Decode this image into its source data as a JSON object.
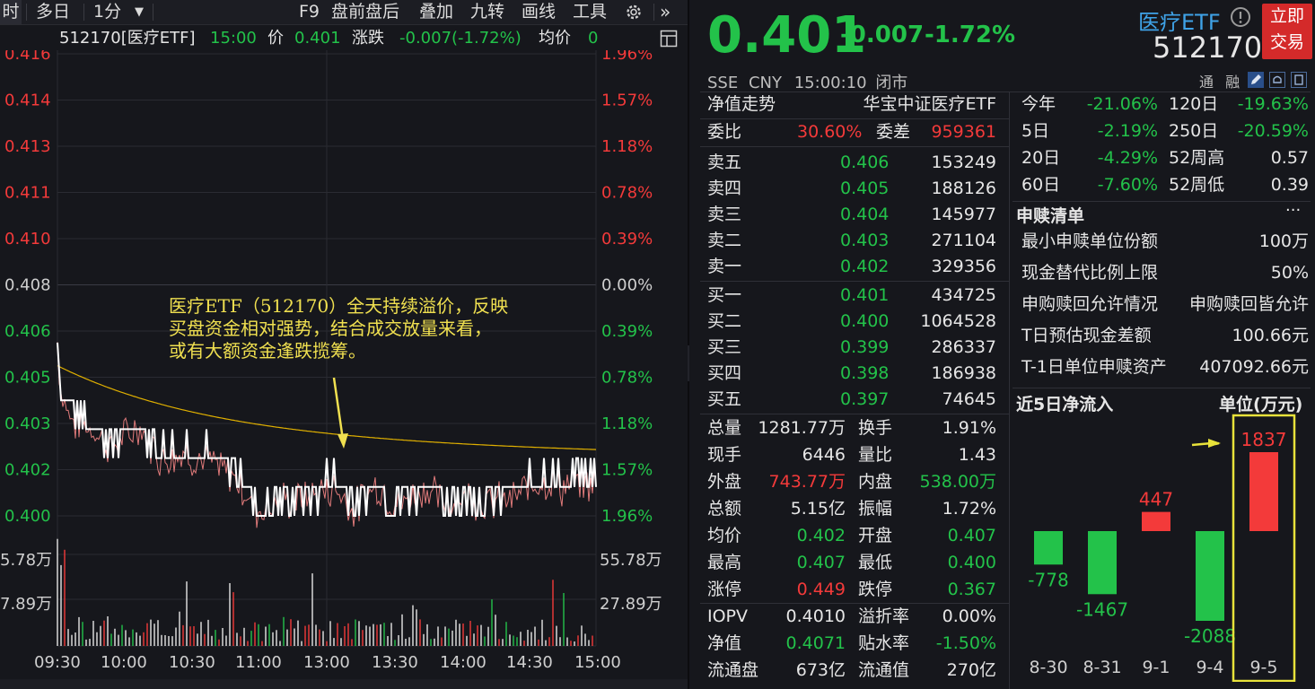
{
  "toolbar": {
    "items": [
      "时",
      "多日",
      "1分",
      "F9",
      "盘前盘后",
      "叠加",
      "九转",
      "画线",
      "工具"
    ],
    "settings_icon": "gear-icon",
    "more_icon": "double-chevron-right-icon"
  },
  "infobar": {
    "title": "512170[医疗ETF]",
    "time": "15:00",
    "price_label": "价",
    "price": "0.401",
    "change_label": "涨跌",
    "change": "-0.007(-1.72%)",
    "avg_label": "均价",
    "avg": "0"
  },
  "chart": {
    "left_ticks": [
      {
        "v": "0.416",
        "c": "up"
      },
      {
        "v": "0.414",
        "c": "up"
      },
      {
        "v": "0.413",
        "c": "up"
      },
      {
        "v": "0.411",
        "c": "up"
      },
      {
        "v": "0.410",
        "c": "up"
      },
      {
        "v": "0.408",
        "c": "flat"
      },
      {
        "v": "0.406",
        "c": "down"
      },
      {
        "v": "0.405",
        "c": "down"
      },
      {
        "v": "0.403",
        "c": "down"
      },
      {
        "v": "0.402",
        "c": "down"
      },
      {
        "v": "0.400",
        "c": "down"
      }
    ],
    "right_ticks": [
      {
        "v": "1.96%",
        "c": "up"
      },
      {
        "v": "1.57%",
        "c": "up"
      },
      {
        "v": "1.18%",
        "c": "up"
      },
      {
        "v": "0.78%",
        "c": "up"
      },
      {
        "v": "0.39%",
        "c": "up"
      },
      {
        "v": "0.00%",
        "c": "flat"
      },
      {
        "v": "0.39%",
        "c": "down"
      },
      {
        "v": "0.78%",
        "c": "down"
      },
      {
        "v": "1.18%",
        "c": "down"
      },
      {
        "v": "1.57%",
        "c": "down"
      },
      {
        "v": "1.96%",
        "c": "down"
      }
    ],
    "vol_left": [
      "5.78万",
      "7.89万"
    ],
    "vol_right": [
      "55.78万",
      "27.89万"
    ],
    "time_labels": [
      "09:30",
      "10:00",
      "10:30",
      "11:00",
      "13:00",
      "13:30",
      "14:00",
      "14:30",
      "15:00"
    ],
    "annotation": [
      "医疗ETF（512170）全天持续溢价，反映",
      "买盘资金相对强势，结合成交放量来看，",
      "或有大额资金逢跌揽筹。"
    ],
    "colors": {
      "up": "#f33a3a",
      "down": "#23c24a",
      "flat": "#cfcfcf",
      "price": "#ffffff",
      "iopv": "#e07a7a",
      "avg": "#e0b000",
      "annotation": "#f0e050"
    }
  },
  "header": {
    "price": "0.401",
    "change": "-0.007",
    "change_pct": "-1.72%",
    "name": "医疗ETF",
    "code": "512170",
    "info_icon": "exclamation-circle-icon",
    "trade_button": [
      "立即",
      "交易"
    ],
    "market": "SSE",
    "currency": "CNY",
    "time": "15:00:10",
    "status": "闭市",
    "tags": [
      "通",
      "融"
    ]
  },
  "order_book": {
    "nav_trend_label": "净值走势",
    "fund_name": "华宝中证医疗ETF",
    "weibi_label": "委比",
    "weibi": "30.60%",
    "weicha_label": "委差",
    "weicha": "959361",
    "asks": [
      {
        "label": "卖五",
        "price": "0.406",
        "vol": "153249"
      },
      {
        "label": "卖四",
        "price": "0.405",
        "vol": "188126"
      },
      {
        "label": "卖三",
        "price": "0.404",
        "vol": "145977"
      },
      {
        "label": "卖二",
        "price": "0.403",
        "vol": "271104"
      },
      {
        "label": "卖一",
        "price": "0.402",
        "vol": "329356"
      }
    ],
    "bids": [
      {
        "label": "买一",
        "price": "0.401",
        "vol": "434725"
      },
      {
        "label": "买二",
        "price": "0.400",
        "vol": "1064528"
      },
      {
        "label": "买三",
        "price": "0.399",
        "vol": "286337"
      },
      {
        "label": "买四",
        "price": "0.398",
        "vol": "186938"
      },
      {
        "label": "买五",
        "price": "0.397",
        "vol": "74645"
      }
    ],
    "stats": [
      {
        "l1": "总量",
        "v1": "1281.77万",
        "c1": "w",
        "l2": "换手",
        "v2": "1.91%",
        "c2": "w"
      },
      {
        "l1": "现手",
        "v1": "6446",
        "c1": "w",
        "l2": "量比",
        "v2": "1.43",
        "c2": "w"
      },
      {
        "l1": "外盘",
        "v1": "743.77万",
        "c1": "r",
        "l2": "内盘",
        "v2": "538.00万",
        "c2": "g"
      },
      {
        "l1": "总额",
        "v1": "5.15亿",
        "c1": "w",
        "l2": "振幅",
        "v2": "1.72%",
        "c2": "w"
      },
      {
        "l1": "均价",
        "v1": "0.402",
        "c1": "g",
        "l2": "开盘",
        "v2": "0.407",
        "c2": "g"
      },
      {
        "l1": "最高",
        "v1": "0.407",
        "c1": "g",
        "l2": "最低",
        "v2": "0.400",
        "c2": "g"
      },
      {
        "l1": "涨停",
        "v1": "0.449",
        "c1": "r",
        "l2": "跌停",
        "v2": "0.367",
        "c2": "g"
      }
    ],
    "stats2": [
      {
        "l1": "IOPV",
        "v1": "0.4010",
        "c1": "w",
        "l2": "溢折率",
        "v2": "0.00%",
        "c2": "w"
      },
      {
        "l1": "净值",
        "v1": "0.4071",
        "c1": "g",
        "l2": "贴水率",
        "v2": "-1.50%",
        "c2": "g"
      },
      {
        "l1": "流通盘",
        "v1": "673亿",
        "c1": "w",
        "l2": "流通值",
        "v2": "270亿",
        "c2": "w"
      }
    ]
  },
  "performance": [
    {
      "l1": "今年",
      "v1": "-21.06%",
      "c1": "g",
      "l2": "120日",
      "v2": "-19.63%",
      "c2": "g"
    },
    {
      "l1": "5日",
      "v1": "-2.19%",
      "c1": "g",
      "l2": "250日",
      "v2": "-20.59%",
      "c2": "g"
    },
    {
      "l1": "20日",
      "v1": "-4.29%",
      "c1": "g",
      "l2": "52周高",
      "v2": "0.57",
      "c2": "w"
    },
    {
      "l1": "60日",
      "v1": "-7.60%",
      "c1": "g",
      "l2": "52周低",
      "v2": "0.39",
      "c2": "w"
    }
  ],
  "redemption": {
    "title": "申赎清单",
    "more": "···",
    "rows": [
      {
        "label": "最小申赎单位份额",
        "value": "100万"
      },
      {
        "label": "现金替代比例上限",
        "value": "50%"
      },
      {
        "label": "申购赎回允许情况",
        "value": "申购赎回皆允许"
      },
      {
        "label": "T日预估现金差额",
        "value": "100.66元"
      },
      {
        "label": "T-1日单位申赎资产",
        "value": "407092.66元"
      }
    ]
  },
  "netflow": {
    "title": "近5日净流入",
    "unit": "单位(万元)"
  },
  "chart_data": {
    "type": "bar",
    "title": "近5日净流入",
    "ylabel": "单位(万元)",
    "categories": [
      "8-30",
      "8-31",
      "9-1",
      "9-4",
      "9-5"
    ],
    "values": [
      -778,
      -1467,
      447,
      -2088,
      1837
    ],
    "colors": {
      "positive": "#f33a3a",
      "negative": "#23c24a"
    },
    "highlight_color": "#e8e23a"
  }
}
